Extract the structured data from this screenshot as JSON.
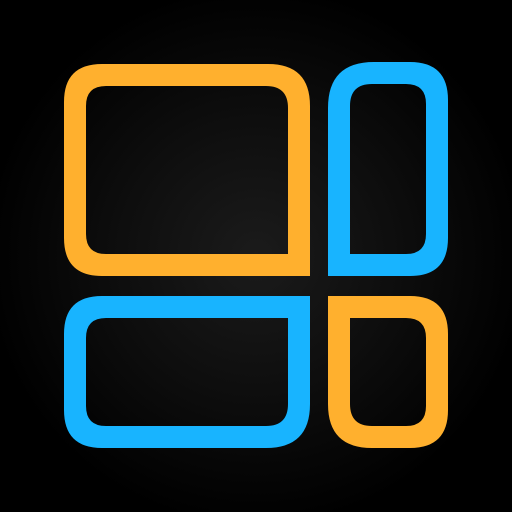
{
  "icon": {
    "name": "dashboard-grid-icon",
    "colors": {
      "background": "#000000",
      "orange": "#FFB02E",
      "orange_shade": "#F5A020",
      "blue": "#18B4FF",
      "blue_shade": "#0E9BF0"
    }
  }
}
